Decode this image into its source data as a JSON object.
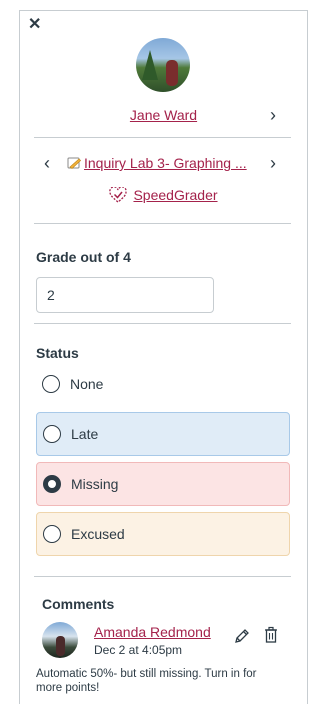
{
  "tray": {
    "close_icon": "close-icon"
  },
  "student": {
    "name": "Jane Ward",
    "next_icon": "chevron-right-icon"
  },
  "assignment": {
    "prev_icon": "chevron-left-icon",
    "next_icon": "chevron-right-icon",
    "icon": "assignment-icon",
    "title": "Inquiry Lab 3- Graphing ..."
  },
  "speedgrader": {
    "icon": "speedgrader-icon",
    "label": "SpeedGrader"
  },
  "grade": {
    "label": "Grade out of 4",
    "value": "2"
  },
  "status": {
    "label": "Status",
    "options": [
      {
        "label": "None",
        "selected": false
      },
      {
        "label": "Late",
        "selected": false
      },
      {
        "label": "Missing",
        "selected": true
      },
      {
        "label": "Excused",
        "selected": false
      }
    ]
  },
  "comments": {
    "title": "Comments",
    "items": [
      {
        "author": "Amanda Redmond",
        "date": "Dec 2 at 4:05pm",
        "body": "Automatic 50%- but still missing. Turn in for more points!",
        "edit_icon": "pencil-icon",
        "delete_icon": "trash-icon"
      }
    ]
  },
  "colors": {
    "link": "#a4224b",
    "text": "#2d3b45",
    "late_bg": "#e0ecf7",
    "missing_bg": "#fce4e4",
    "excused_bg": "#fcf2e4"
  }
}
